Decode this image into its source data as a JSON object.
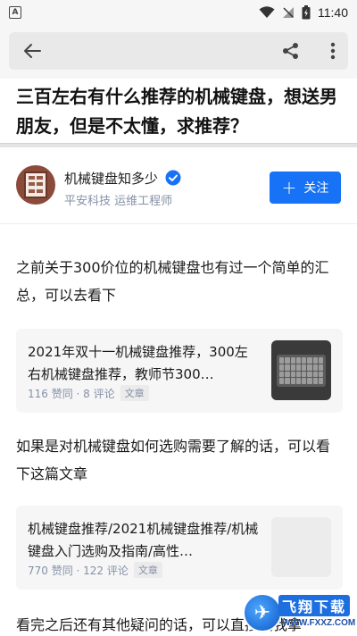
{
  "status_bar": {
    "notification_icon": "A",
    "time": "11:40"
  },
  "browser": {
    "back_icon": "arrow-left",
    "share_icon": "share",
    "more_icon": "more-vertical"
  },
  "question": {
    "title": "三百左右有什么推荐的机械键盘，想送男朋友，但是不太懂，求推荐？"
  },
  "author": {
    "name": "机械键盘知多少",
    "subtitle": "平安科技 运维工程师",
    "follow_label": "关注",
    "verified_color": "#1772f6"
  },
  "content": {
    "para1": "之前关于300价位的机械键盘也有过一个简单的汇总，可以去看下",
    "card1": {
      "title": "2021年双十一机械键盘推荐，300左右机械键盘推荐，教师节300…",
      "meta": "116 赞同 · 8 评论",
      "tag": "文章"
    },
    "para2": "如果是对机械键盘如何选购需要了解的话，可以看下这篇文章",
    "card2": {
      "title": "机械键盘推荐/2021机械键盘推荐/机械键盘入门选购及指南/高性…",
      "meta": "770 赞同 · 122 评论",
      "tag": "文章"
    },
    "para3": "看完之后还有其他疑问的话，可以直接找我拿"
  },
  "watermark": {
    "text": "飞翔下载",
    "url": "WWW.FXXZ.COM"
  },
  "colors": {
    "accent": "#1772f6",
    "meta": "#8590a6"
  }
}
